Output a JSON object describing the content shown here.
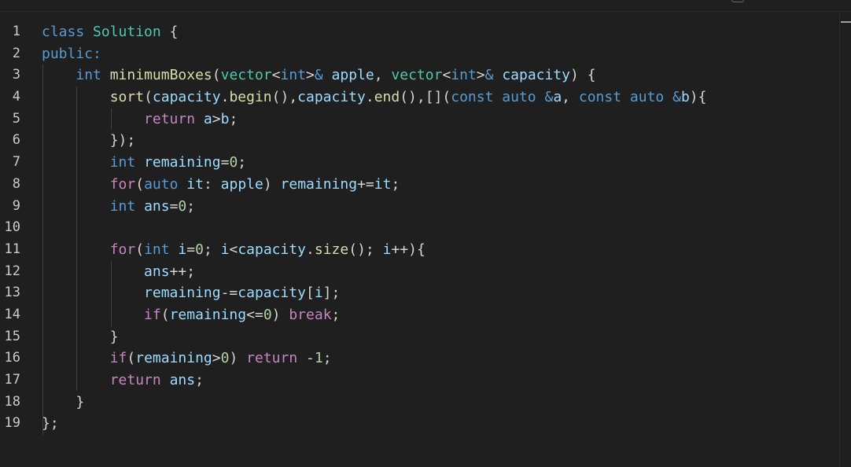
{
  "editor": {
    "language": "cpp",
    "lines": [
      {
        "n": "1",
        "tokens": [
          [
            "kw",
            "class"
          ],
          [
            "op",
            " "
          ],
          [
            "typ",
            "Solution"
          ],
          [
            "op",
            " {"
          ]
        ]
      },
      {
        "n": "2",
        "tokens": [
          [
            "kw",
            "public:"
          ]
        ]
      },
      {
        "n": "3",
        "tokens": [
          [
            "op",
            "    "
          ],
          [
            "kw",
            "int"
          ],
          [
            "op",
            " "
          ],
          [
            "fn",
            "minimumBoxes"
          ],
          [
            "op",
            "("
          ],
          [
            "typ",
            "vector"
          ],
          [
            "op",
            "<"
          ],
          [
            "kw",
            "int"
          ],
          [
            "op",
            ">"
          ],
          [
            "kw",
            "&"
          ],
          [
            "op",
            " "
          ],
          [
            "var",
            "apple"
          ],
          [
            "op",
            ", "
          ],
          [
            "typ",
            "vector"
          ],
          [
            "op",
            "<"
          ],
          [
            "kw",
            "int"
          ],
          [
            "op",
            ">"
          ],
          [
            "kw",
            "&"
          ],
          [
            "op",
            " "
          ],
          [
            "var",
            "capacity"
          ],
          [
            "op",
            ") {"
          ]
        ]
      },
      {
        "n": "4",
        "tokens": [
          [
            "op",
            "        "
          ],
          [
            "fn",
            "sort"
          ],
          [
            "op",
            "("
          ],
          [
            "var",
            "capacity"
          ],
          [
            "op",
            "."
          ],
          [
            "fn",
            "begin"
          ],
          [
            "op",
            "(),"
          ],
          [
            "var",
            "capacity"
          ],
          [
            "op",
            "."
          ],
          [
            "fn",
            "end"
          ],
          [
            "op",
            "(),[]("
          ],
          [
            "kw",
            "const"
          ],
          [
            "op",
            " "
          ],
          [
            "kw",
            "auto"
          ],
          [
            "op",
            " "
          ],
          [
            "kw",
            "&"
          ],
          [
            "var",
            "a"
          ],
          [
            "op",
            ", "
          ],
          [
            "kw",
            "const"
          ],
          [
            "op",
            " "
          ],
          [
            "kw",
            "auto"
          ],
          [
            "op",
            " "
          ],
          [
            "kw",
            "&"
          ],
          [
            "var",
            "b"
          ],
          [
            "op",
            "){"
          ]
        ]
      },
      {
        "n": "5",
        "tokens": [
          [
            "op",
            "            "
          ],
          [
            "ctl",
            "return"
          ],
          [
            "op",
            " "
          ],
          [
            "var",
            "a"
          ],
          [
            "op",
            ">"
          ],
          [
            "var",
            "b"
          ],
          [
            "op",
            ";"
          ]
        ]
      },
      {
        "n": "6",
        "tokens": [
          [
            "op",
            "        });"
          ]
        ]
      },
      {
        "n": "7",
        "tokens": [
          [
            "op",
            "        "
          ],
          [
            "kw",
            "int"
          ],
          [
            "op",
            " "
          ],
          [
            "var",
            "remaining"
          ],
          [
            "op",
            "="
          ],
          [
            "num",
            "0"
          ],
          [
            "op",
            ";"
          ]
        ]
      },
      {
        "n": "8",
        "tokens": [
          [
            "op",
            "        "
          ],
          [
            "ctl",
            "for"
          ],
          [
            "op",
            "("
          ],
          [
            "kw",
            "auto"
          ],
          [
            "op",
            " "
          ],
          [
            "var",
            "it"
          ],
          [
            "op",
            ": "
          ],
          [
            "var",
            "apple"
          ],
          [
            "op",
            ") "
          ],
          [
            "var",
            "remaining"
          ],
          [
            "op",
            "+="
          ],
          [
            "var",
            "it"
          ],
          [
            "op",
            ";"
          ]
        ]
      },
      {
        "n": "9",
        "tokens": [
          [
            "op",
            "        "
          ],
          [
            "kw",
            "int"
          ],
          [
            "op",
            " "
          ],
          [
            "var",
            "ans"
          ],
          [
            "op",
            "="
          ],
          [
            "num",
            "0"
          ],
          [
            "op",
            ";"
          ]
        ]
      },
      {
        "n": "10",
        "tokens": []
      },
      {
        "n": "11",
        "tokens": [
          [
            "op",
            "        "
          ],
          [
            "ctl",
            "for"
          ],
          [
            "op",
            "("
          ],
          [
            "kw",
            "int"
          ],
          [
            "op",
            " "
          ],
          [
            "var",
            "i"
          ],
          [
            "op",
            "="
          ],
          [
            "num",
            "0"
          ],
          [
            "op",
            "; "
          ],
          [
            "var",
            "i"
          ],
          [
            "op",
            "<"
          ],
          [
            "var",
            "capacity"
          ],
          [
            "op",
            "."
          ],
          [
            "fn",
            "size"
          ],
          [
            "op",
            "(); "
          ],
          [
            "var",
            "i"
          ],
          [
            "op",
            "++){"
          ]
        ]
      },
      {
        "n": "12",
        "tokens": [
          [
            "op",
            "            "
          ],
          [
            "var",
            "ans"
          ],
          [
            "op",
            "++;"
          ]
        ]
      },
      {
        "n": "13",
        "tokens": [
          [
            "op",
            "            "
          ],
          [
            "var",
            "remaining"
          ],
          [
            "op",
            "-="
          ],
          [
            "var",
            "capacity"
          ],
          [
            "op",
            "["
          ],
          [
            "var",
            "i"
          ],
          [
            "op",
            "];"
          ]
        ]
      },
      {
        "n": "14",
        "tokens": [
          [
            "op",
            "            "
          ],
          [
            "ctl",
            "if"
          ],
          [
            "op",
            "("
          ],
          [
            "var",
            "remaining"
          ],
          [
            "op",
            "<="
          ],
          [
            "num",
            "0"
          ],
          [
            "op",
            ") "
          ],
          [
            "ctl",
            "break"
          ],
          [
            "op",
            ";"
          ]
        ]
      },
      {
        "n": "15",
        "tokens": [
          [
            "op",
            "        }"
          ]
        ]
      },
      {
        "n": "16",
        "tokens": [
          [
            "op",
            "        "
          ],
          [
            "ctl",
            "if"
          ],
          [
            "op",
            "("
          ],
          [
            "var",
            "remaining"
          ],
          [
            "op",
            ">"
          ],
          [
            "num",
            "0"
          ],
          [
            "op",
            ") "
          ],
          [
            "ctl",
            "return"
          ],
          [
            "op",
            " -"
          ],
          [
            "num",
            "1"
          ],
          [
            "op",
            ";"
          ]
        ]
      },
      {
        "n": "17",
        "tokens": [
          [
            "op",
            "        "
          ],
          [
            "ctl",
            "return"
          ],
          [
            "op",
            " "
          ],
          [
            "var",
            "ans"
          ],
          [
            "op",
            ";"
          ]
        ]
      },
      {
        "n": "18",
        "tokens": [
          [
            "op",
            "    }"
          ]
        ]
      },
      {
        "n": "19",
        "tokens": [
          [
            "op",
            "};"
          ]
        ]
      }
    ]
  },
  "colors": {
    "background": "#1f1f1f",
    "keyword": "#569cd6",
    "control": "#c586c0",
    "type": "#4ec9b0",
    "function": "#dcdcaa",
    "variable": "#9cdcfe",
    "number": "#b5cea8",
    "default": "#d4d4d4",
    "line_number": "#cccccc"
  }
}
